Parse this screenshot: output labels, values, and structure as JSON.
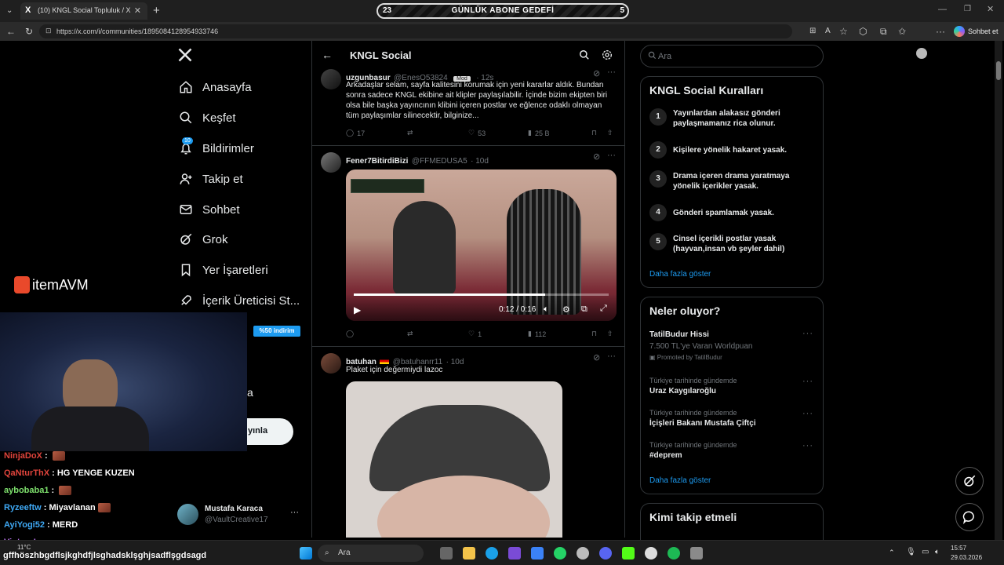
{
  "browser": {
    "tab_title": "(10) KNGL Social Topluluk / X",
    "url": "https://x.com/i/communities/1895084128954933746",
    "sohbet_label": "Sohbet et"
  },
  "goal_banner": {
    "left_count": "23",
    "label": "GÜNLÜK ABONE GEDEFİ",
    "right_count": "5"
  },
  "nav": {
    "items": [
      {
        "label": "Anasayfa"
      },
      {
        "label": "Keşfet"
      },
      {
        "label": "Bildirimler",
        "badge": "10"
      },
      {
        "label": "Takip et"
      },
      {
        "label": "Sohbet"
      },
      {
        "label": "Grok"
      },
      {
        "label": "Yer İşaretleri"
      },
      {
        "label": "İçerik Üreticisi St..."
      }
    ],
    "post_button_partial": "yınla",
    "partial_a": "a",
    "profile": {
      "name": "Mustafa Karaca",
      "handle": "@VaultCreative17"
    }
  },
  "sponsor": {
    "logo_text": "itemAVM",
    "discount": "%50 indirim"
  },
  "feed": {
    "title": "KNGL Social",
    "tweets": [
      {
        "name": "uzgunbasur",
        "handle": "@EnesO53824",
        "badge": "Mod",
        "time": "· 12s",
        "text": "Arkadaşlar selam, sayfa kalitesini korumak için yeni kararlar aldık. Bundan sonra sadece KNGL ekibine ait klipler paylaşılabilir. İçinde bizim ekipten biri olsa bile başka yayıncının klibini içeren postlar ve eğlence odaklı olmayan tüm paylaşımlar silinecektir, bilginize...",
        "replies": "17",
        "retweets": "",
        "likes": "53",
        "views": "25 B"
      },
      {
        "name": "Fener7BitirdiBizi",
        "handle": "@FFMEDUSA5",
        "time": "· 10d",
        "video_time": "0:12 / 0:16",
        "video_progress": 0.75,
        "replies": "",
        "retweets": "",
        "likes": "1",
        "views": "112"
      },
      {
        "name": "batuhan",
        "handle": "@batuhanrr11",
        "time": "· 10d",
        "text": "Plaket için değermiydi lazoc"
      }
    ]
  },
  "right": {
    "search_placeholder": "Ara",
    "rules": {
      "title": "KNGL Social Kuralları",
      "items": [
        {
          "num": "1",
          "text": "Yayınlardan alakasız gönderi paylaşmamanız rica olunur."
        },
        {
          "num": "2",
          "text": "Kişilere yönelik hakaret yasak."
        },
        {
          "num": "3",
          "text": "Drama içeren drama yaratmaya yönelik içerikler yasak."
        },
        {
          "num": "4",
          "text": "Gönderi spamlamak yasak."
        },
        {
          "num": "5",
          "text": "Cinsel içerikli postlar yasak (hayvan,insan vb şeyler dahil)"
        }
      ],
      "more": "Daha fazla göster"
    },
    "trends": {
      "title": "Neler oluyor?",
      "promo": {
        "title": "TatilBudur Hissi",
        "sub": "7.500 TL'ye Varan Worldpuan",
        "promoted": "Promoted by TatilBudur"
      },
      "items": [
        {
          "context": "Türkiye tarihinde gündemde",
          "title": "Uraz Kaygılaroğlu"
        },
        {
          "context": "Türkiye tarihinde gündemde",
          "title": "İçişleri Bakanı Mustafa Çiftçi"
        },
        {
          "context": "Türkiye tarihinde gündemde",
          "title": "#deprem"
        }
      ],
      "more": "Daha fazla göster"
    },
    "follow_title": "Kimi takip etmeli"
  },
  "chat": [
    {
      "user": "NinjaDoX",
      "color": "#e0443c",
      "msg": "",
      "emote": true
    },
    {
      "user": "QaNturThX",
      "color": "#e0443c",
      "msg": "HG YENGE KUZEN",
      "emote": false
    },
    {
      "user": "aybobaba1",
      "color": "#7ee06d",
      "msg": "",
      "emote": true
    },
    {
      "user": "Ryzeeftw",
      "color": "#3fa9f5",
      "msg": "Miyavlanan",
      "emote": true
    },
    {
      "user": "AyiYogi52",
      "color": "#3fa9f5",
      "msg": "MERD",
      "emote": false
    },
    {
      "user": "VintruaL",
      "color": "#b06ee0",
      "msg": "",
      "emote": false
    }
  ],
  "chat_bottom": "gffhöszhbgdflsjkghdfjlsghadsklşghjsadflşgdsagd",
  "taskbar": {
    "search": "Ara",
    "weather": "11°C",
    "time": "15:57",
    "date": "29.03.2026"
  }
}
